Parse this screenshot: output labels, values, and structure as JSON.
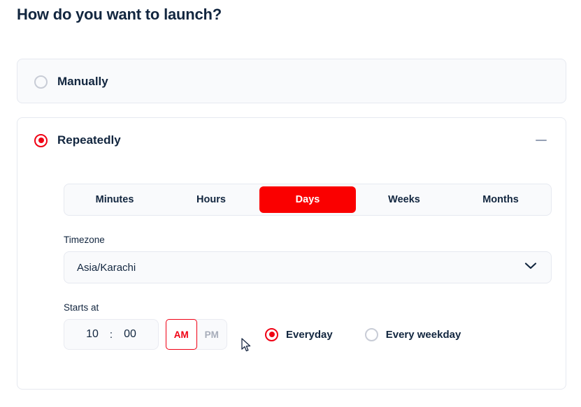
{
  "page": {
    "title": "How do you want to launch?"
  },
  "colors": {
    "accent_red": "#fa0000",
    "radio_red": "#f00014",
    "text_navy": "#12263f",
    "muted": "#a7adba",
    "panel_bg": "#f9fafc",
    "border": "#e6e9f0"
  },
  "options": {
    "manually": {
      "label": "Manually",
      "selected": false,
      "radio_icon": "radio-unchecked-icon"
    },
    "repeatedly": {
      "label": "Repeatedly",
      "selected": true,
      "radio_icon": "radio-checked-icon",
      "collapse_icon": "minus-icon"
    }
  },
  "interval_tabs": [
    {
      "label": "Minutes",
      "active": false
    },
    {
      "label": "Hours",
      "active": false
    },
    {
      "label": "Days",
      "active": true
    },
    {
      "label": "Weeks",
      "active": false
    },
    {
      "label": "Months",
      "active": false
    }
  ],
  "timezone": {
    "label": "Timezone",
    "value": "Asia/Karachi",
    "chevron_icon": "chevron-down-icon"
  },
  "starts_at": {
    "label": "Starts at",
    "hour": "10",
    "separator": ":",
    "minute": "00",
    "meridiem": {
      "am_label": "AM",
      "pm_label": "PM",
      "selected": "AM"
    },
    "frequency": [
      {
        "label": "Everyday",
        "selected": true
      },
      {
        "label": "Every weekday",
        "selected": false
      }
    ]
  },
  "cursor": {
    "icon": "mouse-pointer-icon"
  }
}
